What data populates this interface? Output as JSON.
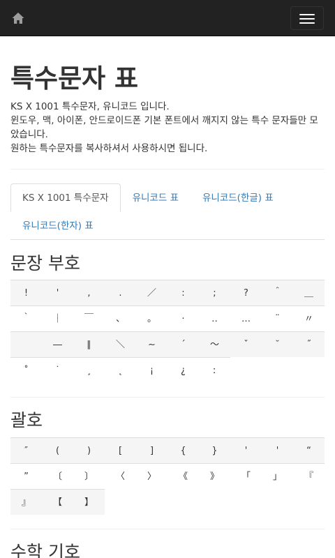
{
  "nav": {
    "home_icon": "home-icon",
    "menu_icon": "hamburger-menu-icon"
  },
  "header": {
    "title": "특수문자 표",
    "intro_1": "KS X 1001 특수문자, 유니코드 입니다.",
    "intro_2": "윈도우, 맥, 아이폰, 안드로이드폰 기본 폰트에서 깨지지 않는 특수 문자들만 모았습니다.",
    "intro_3": "원하는 특수문자를 복사하셔서 사용하시면 됩니다."
  },
  "tabs": [
    {
      "label": "KS X 1001 특수문자",
      "active": true
    },
    {
      "label": "유니코드 표",
      "active": false
    },
    {
      "label": "유니코드(한글) 표",
      "active": false
    },
    {
      "label": "유니코드(한자) 표",
      "active": false
    }
  ],
  "sections": [
    {
      "title": "문장 부호",
      "chars": [
        "!",
        "'",
        ",",
        ".",
        "／",
        ":",
        ";",
        "?",
        "＾",
        "＿",
        "｀",
        "｜",
        "￣",
        "、",
        "。",
        "·",
        "‥",
        "…",
        "¨",
        "〃",
        "",
        "―",
        "∥",
        "＼",
        "∼",
        "´",
        "～",
        "ˇ",
        "˘",
        "˝",
        "˚",
        "˙",
        "¸",
        "˛",
        "¡",
        "¿",
        "ː"
      ]
    },
    {
      "title": "괄호",
      "chars": [
        "″",
        "(",
        ")",
        "[",
        "]",
        "{",
        "}",
        "'",
        "'",
        "“",
        "”",
        "〔",
        "〕",
        "〈",
        "〉",
        "《",
        "》",
        "「",
        "」",
        "『",
        "』",
        "【",
        "】"
      ]
    },
    {
      "title": "수학 기호",
      "chars": []
    }
  ]
}
